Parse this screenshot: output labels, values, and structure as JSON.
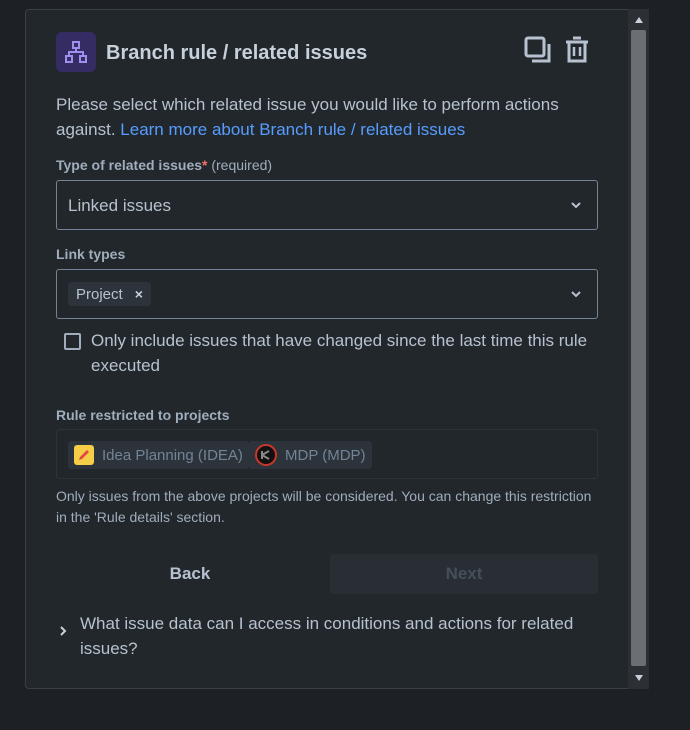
{
  "header": {
    "title": "Branch rule / related issues"
  },
  "description": {
    "text": "Please select which related issue you would like to perform actions against.",
    "link": "Learn more about Branch rule / related issues"
  },
  "type_field": {
    "label": "Type of related issues",
    "required_marker": "*",
    "required_text": "(required)",
    "value": "Linked issues"
  },
  "link_types": {
    "label": "Link types",
    "tags": [
      "Project"
    ]
  },
  "checkbox": {
    "label": "Only include issues that have changed since the last time this rule executed",
    "checked": false
  },
  "projects": {
    "label": "Rule restricted to projects",
    "items": [
      {
        "name": "Idea Planning (IDEA)",
        "icon": "pencil-icon"
      },
      {
        "name": "MDP (MDP)",
        "icon": "mdp-logo-icon"
      }
    ],
    "helper": "Only issues from the above projects will be considered. You can change this restriction in the 'Rule details' section."
  },
  "buttons": {
    "back": "Back",
    "next": "Next"
  },
  "expander": {
    "text": "What issue data can I access in conditions and actions for related issues?"
  },
  "colors": {
    "accent_link": "#579dff",
    "panel_bg": "#22272b",
    "page_bg": "#1d2125",
    "icon_bg": "#352c63"
  }
}
